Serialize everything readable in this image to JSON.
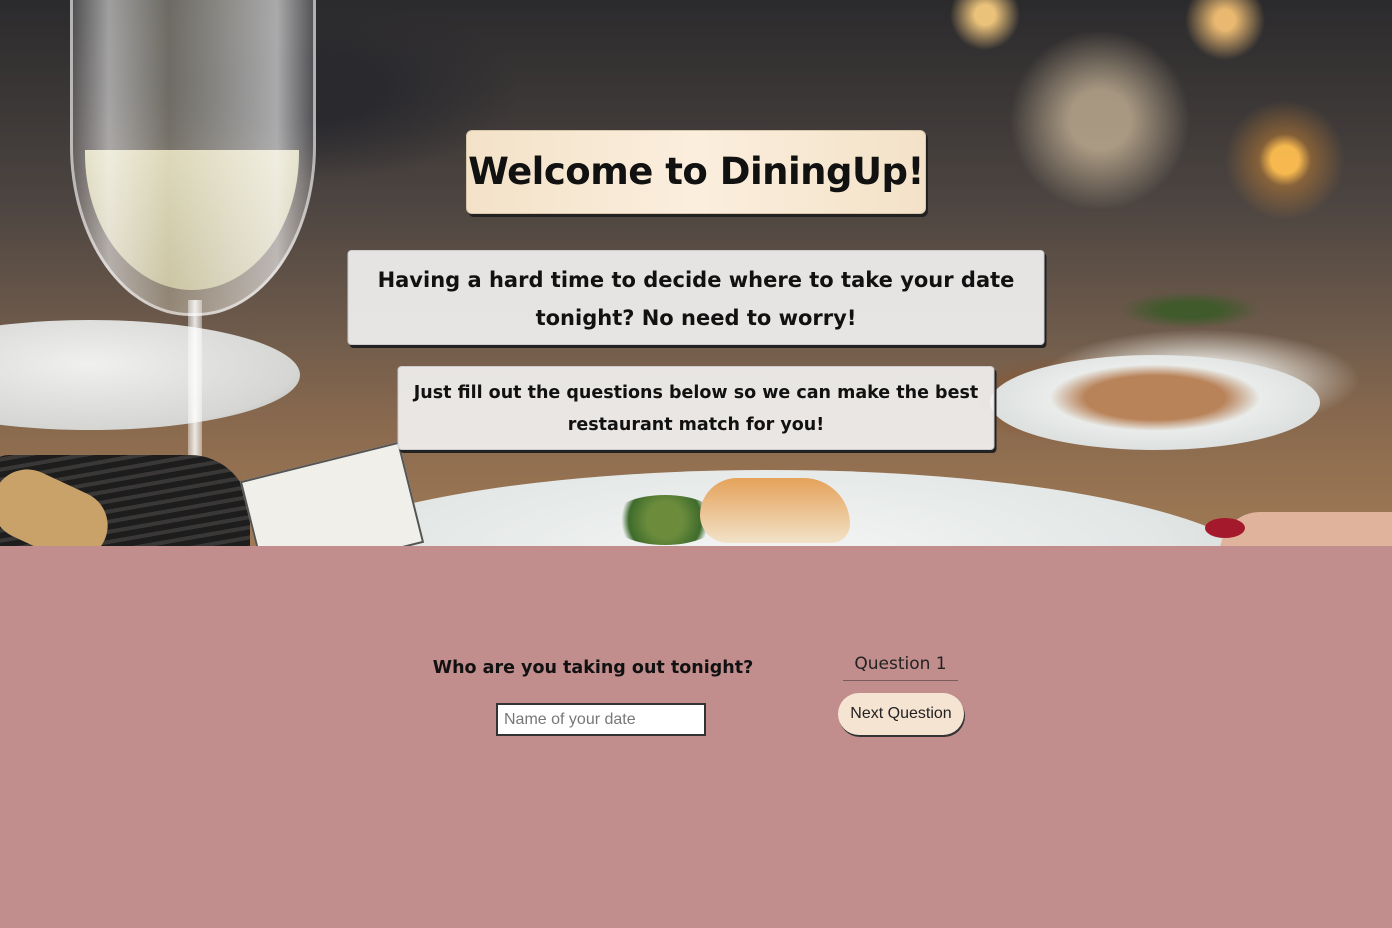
{
  "hero": {
    "title": "Welcome to DiningUp!",
    "tagline": "Having a hard time to decide where to take your date tonight? No need to worry!",
    "instructions": "Just fill out the questions below so we can make the best restaurant match for you!"
  },
  "quiz": {
    "question": "Who are you taking out tonight?",
    "answer_placeholder": "Name of your date",
    "answer_value": "",
    "question_counter": "Question 1",
    "next_button_label": "Next Question"
  },
  "colors": {
    "quiz_background": "#c18d8d",
    "title_background": "#f3e2c8",
    "button_background": "#f6e4d3"
  },
  "icons": {
    "hero_image": "restaurant-dining-table-photo"
  }
}
